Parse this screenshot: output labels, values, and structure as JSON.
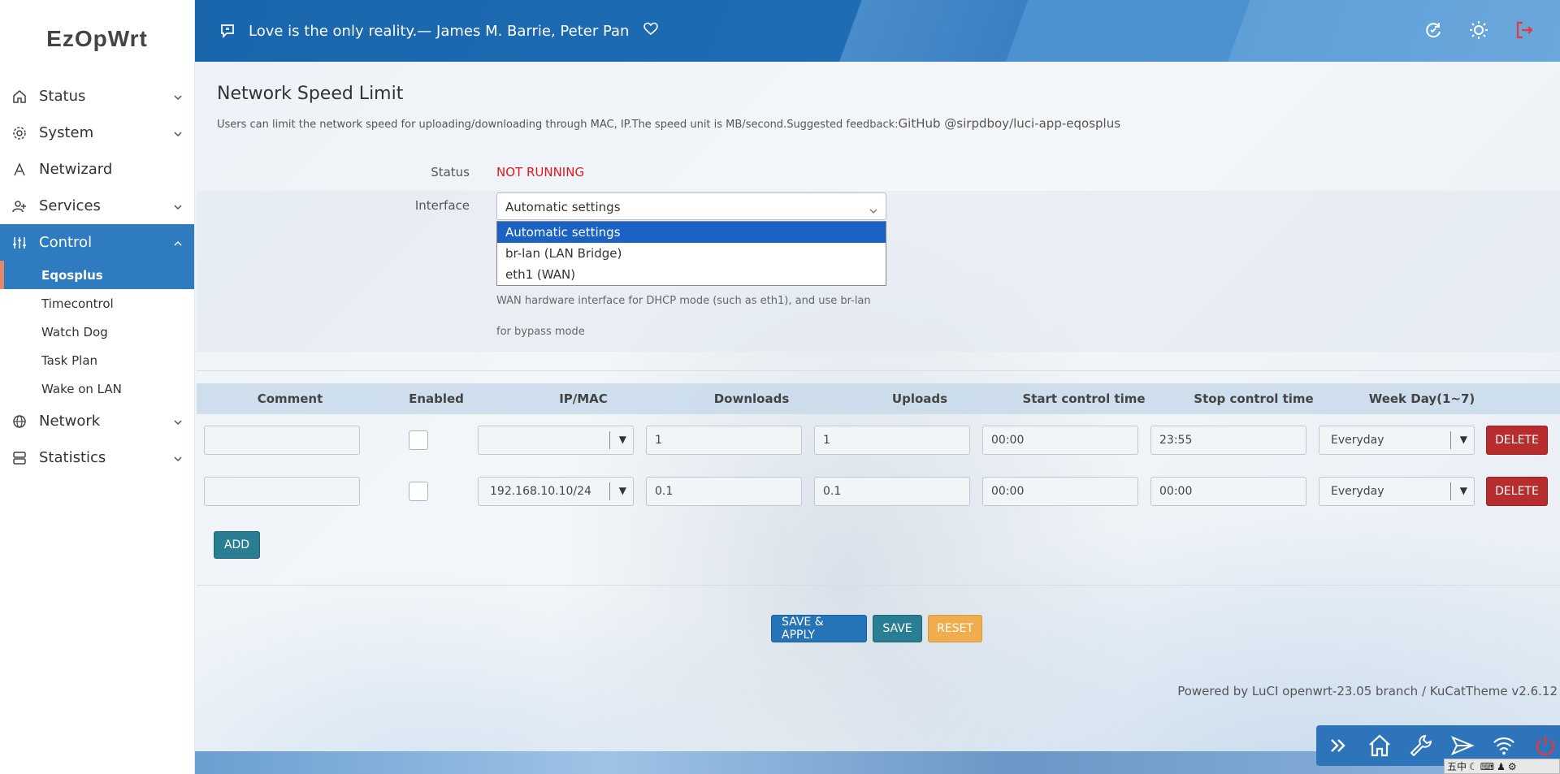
{
  "brand": "EzOpWrt",
  "sidebar": {
    "items": [
      {
        "label": "Status",
        "icon": "home-icon"
      },
      {
        "label": "System",
        "icon": "gear-icon"
      },
      {
        "label": "Netwizard",
        "icon": "wizard-icon"
      },
      {
        "label": "Services",
        "icon": "user-plus-icon"
      },
      {
        "label": "Control",
        "icon": "sliders-icon"
      },
      {
        "label": "Network",
        "icon": "globe-icon"
      },
      {
        "label": "Statistics",
        "icon": "database-icon"
      }
    ],
    "control_sub": [
      "Eqosplus",
      "Timecontrol",
      "Watch Dog",
      "Task Plan",
      "Wake on LAN"
    ]
  },
  "header": {
    "quote": "Love is the only reality.— James M. Barrie, Peter Pan"
  },
  "page": {
    "title": "Network Speed Limit",
    "description": "Users can limit the network speed for uploading/downloading through MAC, IP.The speed unit is MB/second.Suggested feedback:",
    "description_link": "GitHub @sirpdboy/luci-app-eqosplus"
  },
  "form": {
    "status_label": "Status",
    "status_value": "NOT RUNNING",
    "interface_label": "Interface",
    "interface_value": "Automatic settings",
    "interface_options": [
      "Automatic settings",
      "br-lan (LAN Bridge)",
      "eth1 (WAN)"
    ],
    "hint": "WAN hardware interface for DHCP mode (such as eth1), and use br-lan for bypass mode"
  },
  "table": {
    "headers": [
      "Comment",
      "Enabled",
      "IP/MAC",
      "Downloads",
      "Uploads",
      "Start control time",
      "Stop control time",
      "Week Day(1~7)"
    ],
    "rows": [
      {
        "comment": "",
        "ipmac": "",
        "downloads": "1",
        "uploads": "1",
        "start": "00:00",
        "stop": "23:55",
        "weekday": "Everyday",
        "delete": "DELETE"
      },
      {
        "comment": "",
        "ipmac": "192.168.10.10/24",
        "downloads": "0.1",
        "uploads": "0.1",
        "start": "00:00",
        "stop": "00:00",
        "weekday": "Everyday",
        "delete": "DELETE"
      }
    ],
    "add_label": "ADD"
  },
  "actions": {
    "save_apply": "SAVE & APPLY",
    "save": "SAVE",
    "reset": "RESET"
  },
  "footer": "Powered by LuCI openwrt-23.05 branch / KuCatTheme v2.6.12",
  "tray": "五中"
}
